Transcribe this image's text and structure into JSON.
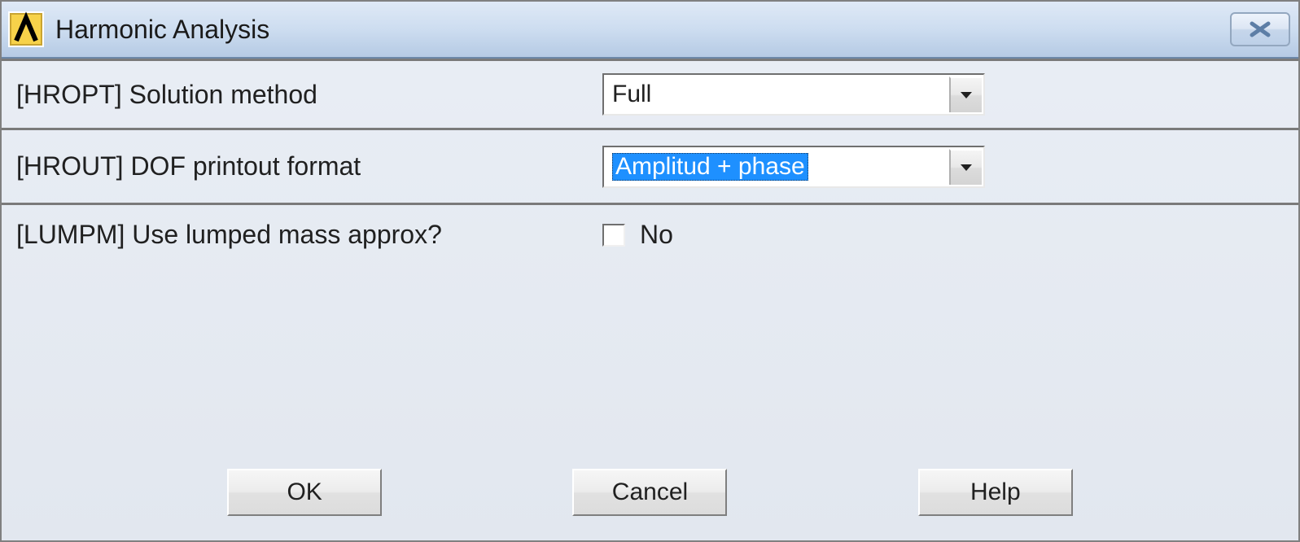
{
  "window": {
    "title": "Harmonic Analysis"
  },
  "rows": {
    "hropt": {
      "label": "[HROPT]  Solution method",
      "selected": "Full"
    },
    "hrout": {
      "label": "[HROUT]  DOF printout format",
      "selected": "Amplitud + phase"
    },
    "lumpm": {
      "label": "[LUMPM]  Use lumped mass approx?",
      "checkbox_label": "No"
    }
  },
  "buttons": {
    "ok": "OK",
    "cancel": "Cancel",
    "help": "Help"
  }
}
